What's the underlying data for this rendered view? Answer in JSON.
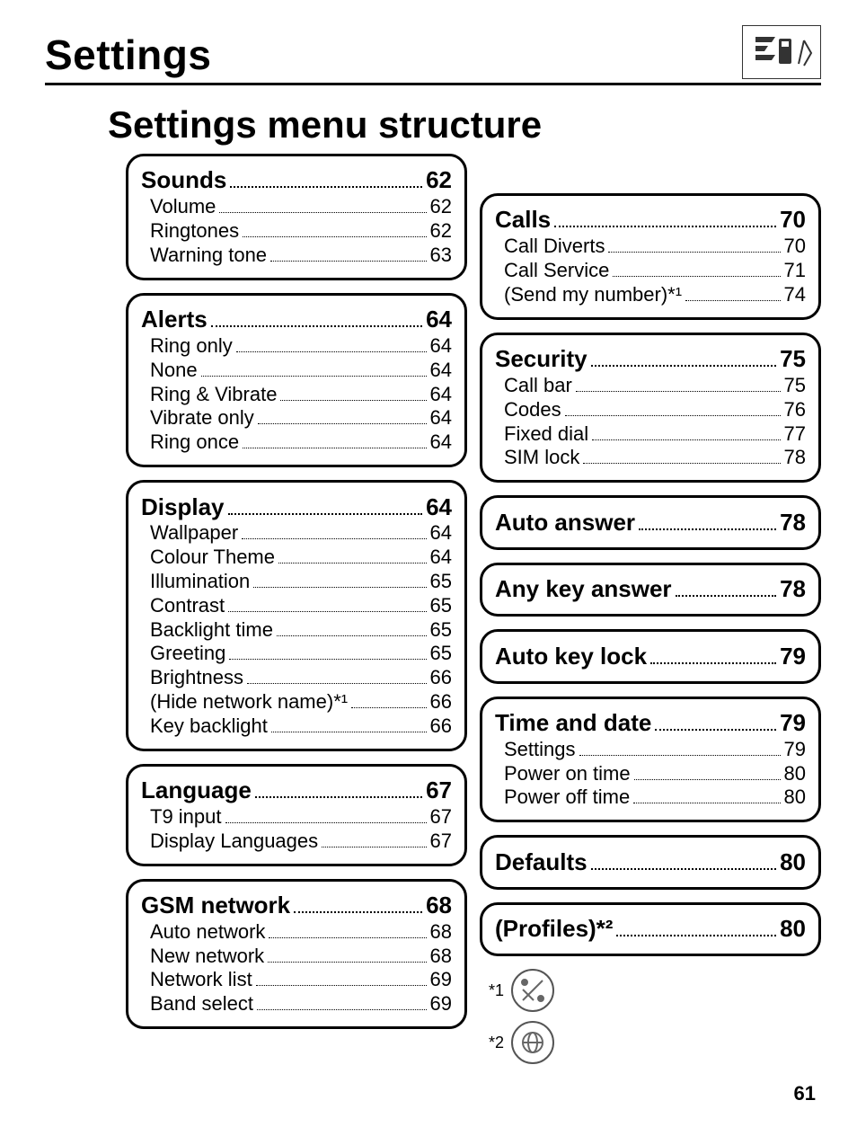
{
  "header": {
    "title": "Settings"
  },
  "subtitle": "Settings menu structure",
  "page_number": "61",
  "columns": [
    {
      "sections": [
        {
          "heading": {
            "label": "Sounds",
            "page": "62"
          },
          "items": [
            {
              "label": "Volume",
              "page": "62"
            },
            {
              "label": "Ringtones",
              "page": "62"
            },
            {
              "label": "Warning tone",
              "page": "63"
            }
          ]
        },
        {
          "heading": {
            "label": "Alerts",
            "page": "64"
          },
          "items": [
            {
              "label": "Ring only",
              "page": "64"
            },
            {
              "label": "None",
              "page": "64"
            },
            {
              "label": "Ring & Vibrate",
              "page": "64"
            },
            {
              "label": "Vibrate only",
              "page": "64"
            },
            {
              "label": "Ring once",
              "page": "64"
            }
          ]
        },
        {
          "heading": {
            "label": "Display",
            "page": "64"
          },
          "items": [
            {
              "label": "Wallpaper",
              "page": "64"
            },
            {
              "label": "Colour Theme",
              "page": "64"
            },
            {
              "label": "Illumination",
              "page": "65"
            },
            {
              "label": "Contrast",
              "page": "65"
            },
            {
              "label": "Backlight time",
              "page": "65"
            },
            {
              "label": "Greeting",
              "page": "65"
            },
            {
              "label": "Brightness",
              "page": "66"
            },
            {
              "label": "(Hide network name)*¹",
              "page": "66"
            },
            {
              "label": "Key backlight",
              "page": "66"
            }
          ]
        },
        {
          "heading": {
            "label": "Language",
            "page": "67"
          },
          "items": [
            {
              "label": "T9 input",
              "page": "67"
            },
            {
              "label": "Display Languages",
              "page": "67"
            }
          ]
        },
        {
          "heading": {
            "label": "GSM network",
            "page": "68"
          },
          "items": [
            {
              "label": "Auto network",
              "page": "68"
            },
            {
              "label": "New network",
              "page": "68"
            },
            {
              "label": "Network list",
              "page": "69"
            },
            {
              "label": "Band select",
              "page": "69"
            }
          ]
        }
      ]
    },
    {
      "sections": [
        {
          "heading": {
            "label": "Calls",
            "page": "70"
          },
          "items": [
            {
              "label": "Call Diverts",
              "page": "70"
            },
            {
              "label": "Call Service",
              "page": "71"
            },
            {
              "label": "(Send my number)*¹",
              "page": "74"
            }
          ]
        },
        {
          "heading": {
            "label": "Security",
            "page": "75"
          },
          "items": [
            {
              "label": "Call bar",
              "page": "75"
            },
            {
              "label": "Codes",
              "page": "76"
            },
            {
              "label": "Fixed dial",
              "page": "77"
            },
            {
              "label": "SIM lock",
              "page": "78"
            }
          ]
        },
        {
          "heading": {
            "label": "Auto answer",
            "page": "78"
          },
          "items": []
        },
        {
          "heading": {
            "label": "Any key answer",
            "page": "78"
          },
          "items": []
        },
        {
          "heading": {
            "label": "Auto key lock",
            "page": "79"
          },
          "items": []
        },
        {
          "heading": {
            "label": "Time and date",
            "page": "79"
          },
          "items": [
            {
              "label": "Settings",
              "page": "79"
            },
            {
              "label": "Power on time",
              "page": "80"
            },
            {
              "label": "Power off time",
              "page": "80"
            }
          ]
        },
        {
          "heading": {
            "label": "Defaults",
            "page": "80"
          },
          "items": []
        },
        {
          "heading": {
            "label": "(Profiles)*²",
            "page": "80"
          },
          "items": []
        }
      ]
    }
  ],
  "footnotes": {
    "fn1_marker": "*1",
    "fn2_marker": "*2"
  }
}
